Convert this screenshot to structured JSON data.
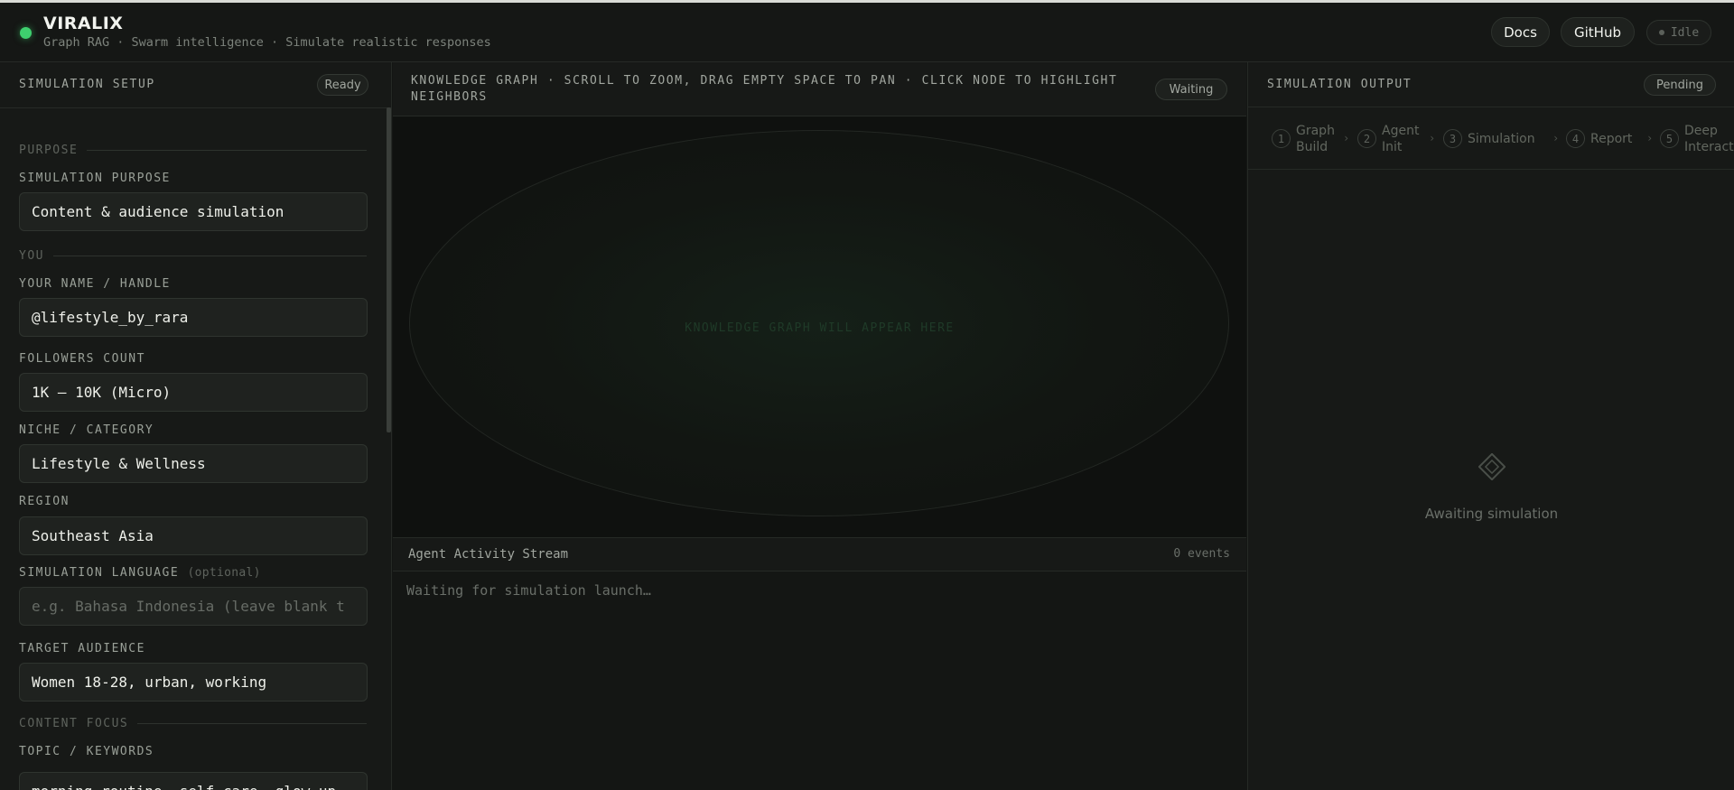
{
  "header": {
    "brand": "VIRALIX",
    "tagline": "Graph RAG · Swarm intelligence · Simulate realistic responses",
    "docs_label": "Docs",
    "github_label": "GitHub",
    "status_label": "Idle"
  },
  "setup": {
    "title": "SIMULATION SETUP",
    "status": "Ready",
    "sections": {
      "purpose": "PURPOSE",
      "you": "YOU",
      "content_focus": "CONTENT FOCUS"
    },
    "fields": {
      "purpose": {
        "label": "SIMULATION PURPOSE",
        "value": "Content & audience simulation"
      },
      "name": {
        "label": "YOUR NAME / HANDLE",
        "value": "@lifestyle_by_rara"
      },
      "followers": {
        "label": "FOLLOWERS COUNT",
        "value": "1K – 10K (Micro)"
      },
      "niche": {
        "label": "NICHE / CATEGORY",
        "value": "Lifestyle & Wellness"
      },
      "region": {
        "label": "REGION",
        "value": "Southeast Asia"
      },
      "language": {
        "label": "SIMULATION LANGUAGE",
        "optional": "(optional)",
        "placeholder": "e.g. Bahasa Indonesia (leave blank t"
      },
      "audience": {
        "label": "TARGET AUDIENCE",
        "value": "Women 18-28, urban, working"
      },
      "topic": {
        "label": "TOPIC / KEYWORDS",
        "value": "morning routine, self-care, glow-up"
      }
    }
  },
  "graph": {
    "title_line1": "KNOWLEDGE GRAPH · SCROLL TO ZOOM, DRAG EMPTY SPACE TO PAN · CLICK NODE TO HIGHLIGHT",
    "title_line2": "NEIGHBORS",
    "status": "Waiting",
    "empty_hint": "KNOWLEDGE GRAPH WILL APPEAR HERE"
  },
  "stream": {
    "title": "Agent Activity Stream",
    "count": "0 events",
    "waiting": "Waiting for simulation launch…"
  },
  "output": {
    "title": "SIMULATION OUTPUT",
    "status": "Pending",
    "steps": [
      {
        "num": "1",
        "line1": "Graph",
        "line2": "Build"
      },
      {
        "num": "2",
        "line1": "Agent",
        "line2": "Init"
      },
      {
        "num": "3",
        "line1": "Simulation",
        "line2": ""
      },
      {
        "num": "4",
        "line1": "Report",
        "line2": ""
      },
      {
        "num": "5",
        "line1": "Deep",
        "line2": "Interaction"
      }
    ],
    "empty_icon": "diamond-icon",
    "empty_text": "Awaiting simulation"
  }
}
